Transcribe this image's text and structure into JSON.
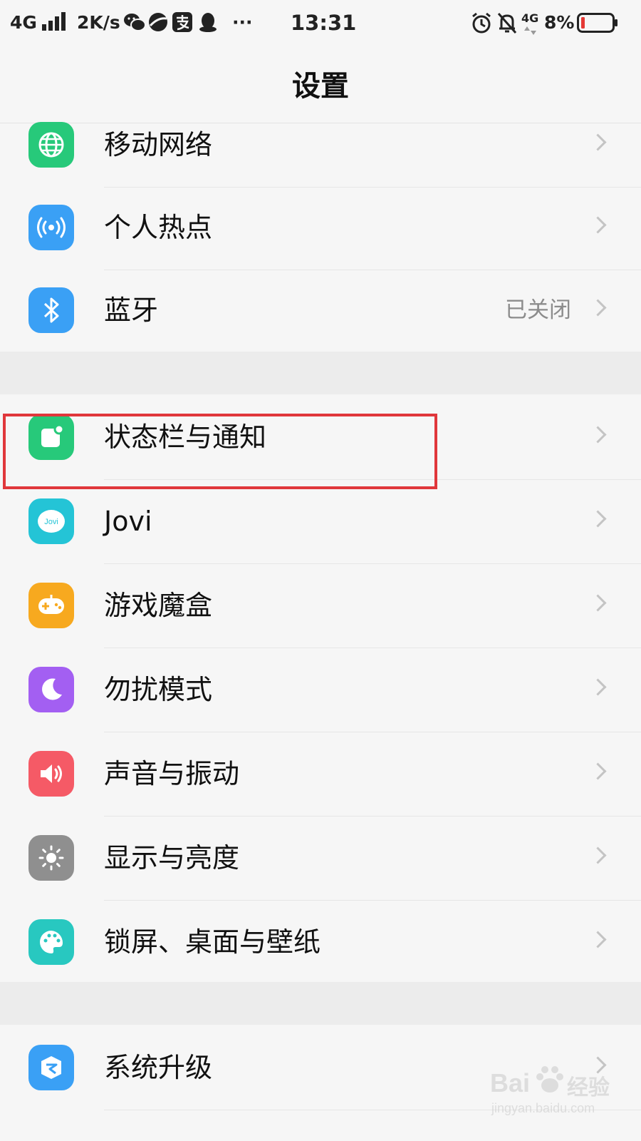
{
  "status_bar": {
    "network": "4G",
    "speed": "2K/s",
    "more": "···",
    "time": "13:31",
    "network_right": "4G",
    "battery": "8%"
  },
  "header": {
    "title": "设置"
  },
  "sections": [
    {
      "items": [
        {
          "label": "移动网络",
          "icon": "globe-icon",
          "color": "#27c97a"
        },
        {
          "label": "个人热点",
          "icon": "hotspot-icon",
          "color": "#3aa0f5"
        },
        {
          "label": "蓝牙",
          "icon": "bluetooth-icon",
          "color": "#3aa0f5",
          "value": "已关闭"
        }
      ]
    },
    {
      "items": [
        {
          "label": "状态栏与通知",
          "icon": "notification-icon",
          "color": "#27c97a"
        },
        {
          "label": "Jovi",
          "icon": "jovi-icon",
          "color": "#24c4d6",
          "icon_text": "Jovi"
        },
        {
          "label": "游戏魔盒",
          "icon": "gamepad-icon",
          "color": "#f7a91f"
        },
        {
          "label": "勿扰模式",
          "icon": "moon-icon",
          "color": "#a35ff2"
        },
        {
          "label": "声音与振动",
          "icon": "speaker-icon",
          "color": "#f55a66"
        },
        {
          "label": "显示与亮度",
          "icon": "brightness-icon",
          "color": "#8f8f8f"
        },
        {
          "label": "锁屏、桌面与壁纸",
          "icon": "palette-icon",
          "color": "#28c8c0"
        }
      ]
    },
    {
      "items": [
        {
          "label": "系统升级",
          "icon": "system-update-icon",
          "color": "#3aa0f5"
        }
      ]
    }
  ],
  "watermark": {
    "brand": "Bai",
    "brand_cn": "经验",
    "url": "jingyan.baidu.com"
  }
}
